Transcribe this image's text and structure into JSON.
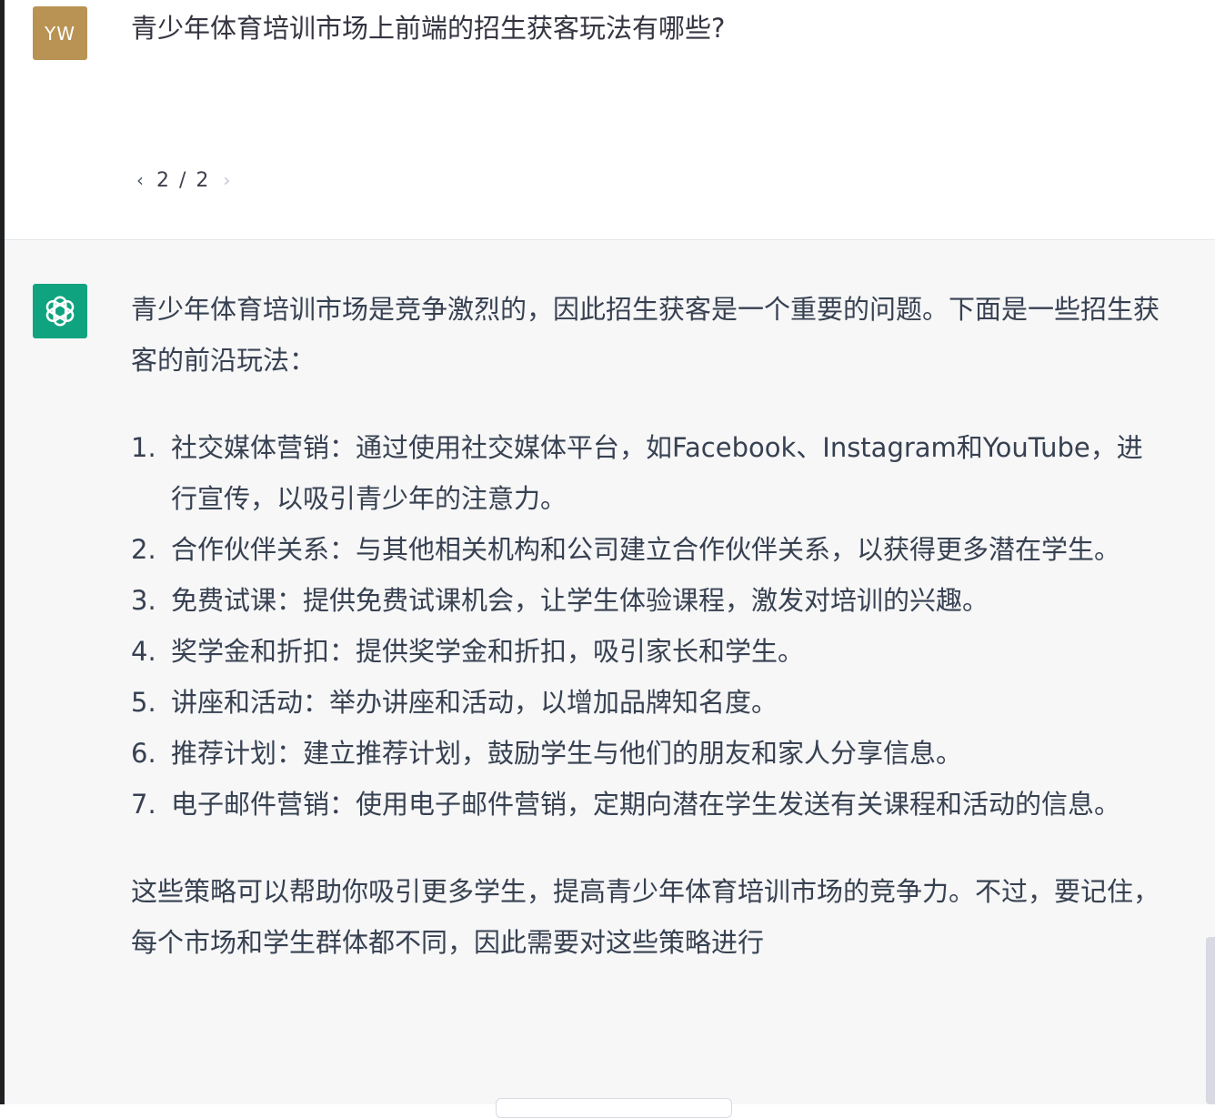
{
  "user_message": {
    "avatar_initials": "YW",
    "text": "青少年体育培训市场上前端的招生获客玩法有哪些?",
    "pager": {
      "prev_icon": "‹",
      "next_icon": "›",
      "label": "2 / 2"
    }
  },
  "assistant_message": {
    "avatar_icon": "openai-logo-icon",
    "intro": "青少年体育培训市场是竞争激烈的，因此招生获客是一个重要的问题。下面是一些招生获客的前沿玩法：",
    "items": [
      {
        "num": "1.",
        "text": "社交媒体营销：通过使用社交媒体平台，如Facebook、Instagram和YouTube，进行宣传，以吸引青少年的注意力。"
      },
      {
        "num": "2.",
        "text": "合作伙伴关系：与其他相关机构和公司建立合作伙伴关系，以获得更多潜在学生。"
      },
      {
        "num": "3.",
        "text": "免费试课：提供免费试课机会，让学生体验课程，激发对培训的兴趣。"
      },
      {
        "num": "4.",
        "text": "奖学金和折扣：提供奖学金和折扣，吸引家长和学生。"
      },
      {
        "num": "5.",
        "text": "讲座和活动：举办讲座和活动，以增加品牌知名度。"
      },
      {
        "num": "6.",
        "text": "推荐计划：建立推荐计划，鼓励学生与他们的朋友和家人分享信息。"
      },
      {
        "num": "7.",
        "text": "电子邮件营销：使用电子邮件营销，定期向潜在学生发送有关课程和活动的信息。"
      }
    ],
    "outro": "这些策略可以帮助你吸引更多学生，提高青少年体育培训市场的竞争力。不过，要记住，每个市场和学生群体都不同，因此需要对这些策略进行"
  },
  "colors": {
    "user_avatar": "#b99354",
    "assistant_avatar": "#10a37f",
    "assistant_bg": "#f7f7f8",
    "text": "#374151"
  }
}
